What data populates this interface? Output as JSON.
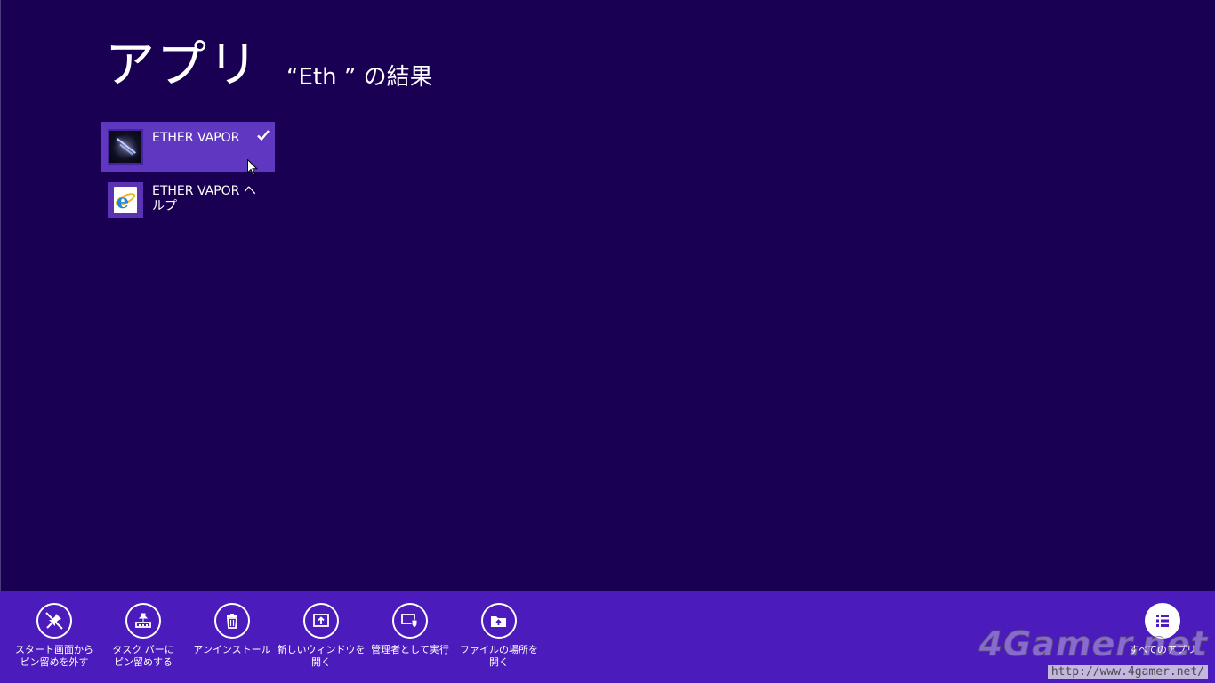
{
  "header": {
    "title": "アプリ",
    "query_label": "“Eth ” の結果"
  },
  "results": [
    {
      "label": "ETHER VAPOR",
      "selected": true,
      "icon": "ether-vapor-app-icon"
    },
    {
      "label": "ETHER VAPOR ヘルプ",
      "selected": false,
      "icon": "ie-help-document-icon"
    }
  ],
  "app_bar": {
    "commands": [
      {
        "label": "スタート画面から\nピン留めを外す",
        "icon": "unpin-icon"
      },
      {
        "label": "タスク バーに\nピン留めする",
        "icon": "pin-taskbar-icon"
      },
      {
        "label": "アンインストール",
        "icon": "trash-icon"
      },
      {
        "label": "新しいウィンドウを\n開く",
        "icon": "new-window-icon"
      },
      {
        "label": "管理者として実行",
        "icon": "run-as-admin-icon"
      },
      {
        "label": "ファイルの場所を\n開く",
        "icon": "open-folder-icon"
      }
    ],
    "all_apps_label": "すべてのアプリ"
  },
  "watermark": {
    "logo": "4Gamer.net",
    "url": "http://www.4gamer.net/"
  },
  "colors": {
    "background": "#1a0052",
    "selection": "#5f37c1",
    "app_bar": "#4b1bbc"
  }
}
